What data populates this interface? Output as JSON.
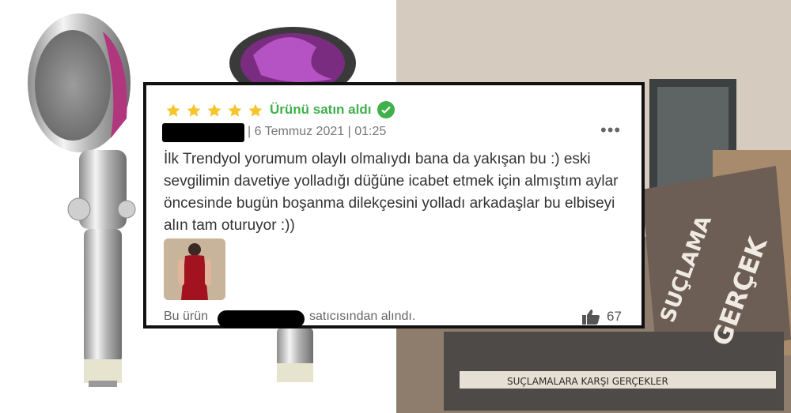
{
  "review": {
    "rating": 5,
    "purchase_label": "Ürünü satın aldı",
    "meta": "| 6 Temmuz 2021 | 01:25",
    "menu_icon": "more-dots-icon",
    "text": "İlk Trendyol yorumum olaylı olmalıydı bana da yakışan bu :) eski sevgilimin davetiye yolladığı düğüne icabet etmek için almıştım aylar öncesinde bugün boşanma dilekçesini yolladı arkadaşlar bu elbiseyi alın tam oturuyor :))",
    "footer_prefix": "Bu ürün",
    "footer_suffix": "satıcısından alındı.",
    "likes": "67"
  },
  "colors": {
    "star": "#f5c52b",
    "verified": "#3fb04a"
  },
  "backdrop": {
    "book_spine": "SUÇLAMALARA KARŞI GERÇEKLER",
    "book_cover_top": "SUÇLAMA",
    "book_cover_main": "GERÇEK"
  }
}
